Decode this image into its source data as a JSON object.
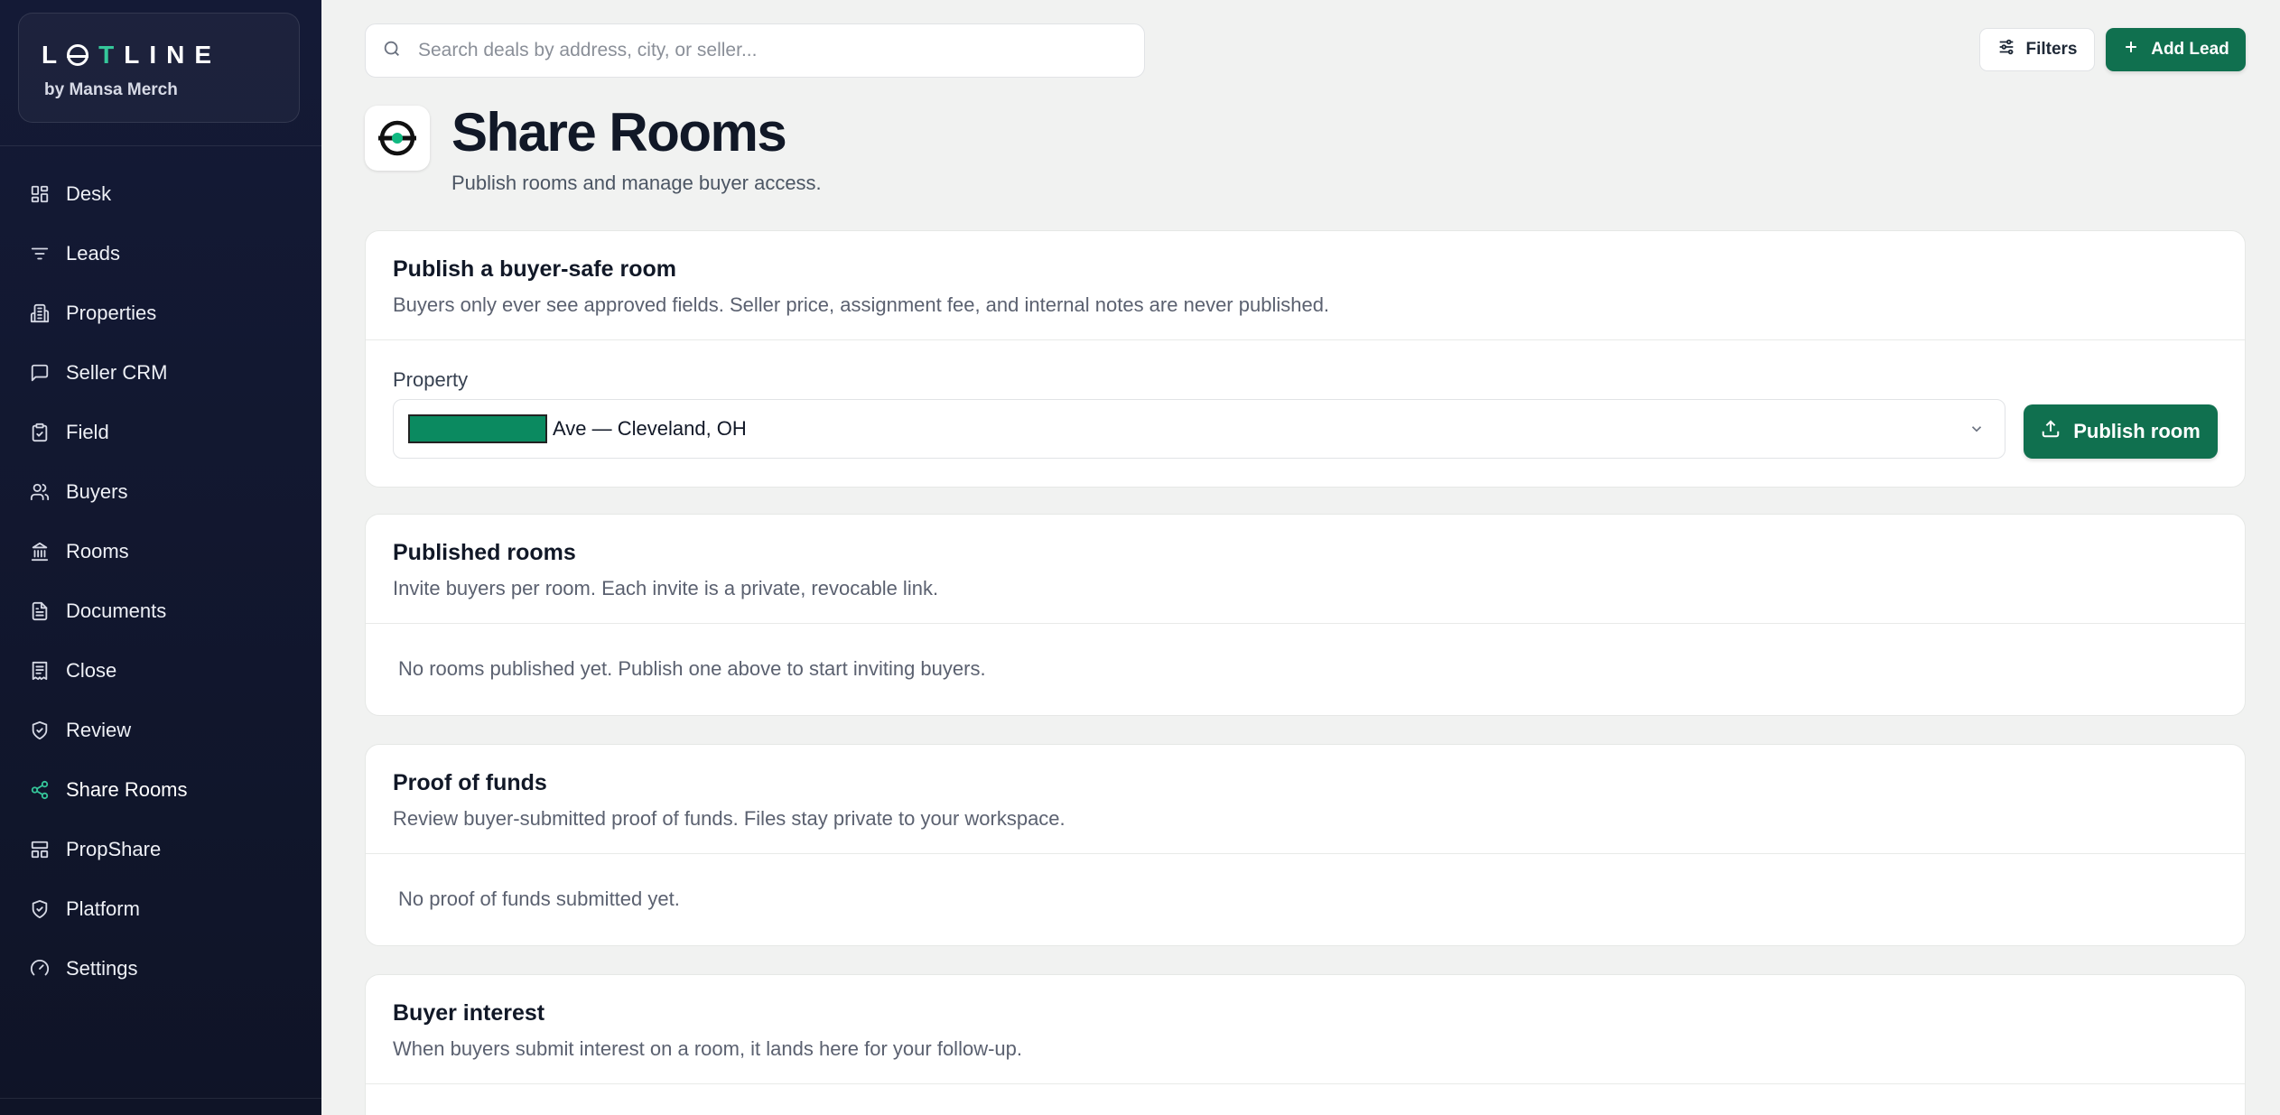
{
  "brand": {
    "logo_parts": [
      "L",
      "",
      "T",
      "LINE"
    ],
    "subtitle": "by Mansa Merch"
  },
  "sidebar": {
    "items": [
      {
        "label": "Desk",
        "icon": "grid-icon",
        "active": false
      },
      {
        "label": "Leads",
        "icon": "filter-lines-icon",
        "active": false
      },
      {
        "label": "Properties",
        "icon": "building-icon",
        "active": false
      },
      {
        "label": "Seller CRM",
        "icon": "message-icon",
        "active": false
      },
      {
        "label": "Field",
        "icon": "clipboard-icon",
        "active": false
      },
      {
        "label": "Buyers",
        "icon": "users-icon",
        "active": false
      },
      {
        "label": "Rooms",
        "icon": "bank-icon",
        "active": false
      },
      {
        "label": "Documents",
        "icon": "file-icon",
        "active": false
      },
      {
        "label": "Close",
        "icon": "receipt-icon",
        "active": false
      },
      {
        "label": "Review",
        "icon": "shield-check-icon",
        "active": false
      },
      {
        "label": "Share Rooms",
        "icon": "share-icon",
        "active": true
      },
      {
        "label": "PropShare",
        "icon": "layout-icon",
        "active": false
      },
      {
        "label": "Platform",
        "icon": "shield-check-icon",
        "active": false
      },
      {
        "label": "Settings",
        "icon": "gauge-icon",
        "active": false
      }
    ]
  },
  "topbar": {
    "search_placeholder": "Search deals by address, city, or seller...",
    "filters_label": "Filters",
    "add_lead_label": "Add Lead"
  },
  "header": {
    "title": "Share Rooms",
    "subtitle": "Publish rooms and manage buyer access."
  },
  "publish_card": {
    "title": "Publish a buyer-safe room",
    "description": "Buyers only ever see approved fields. Seller price, assignment fee, and internal notes are never published.",
    "property_label": "Property",
    "property_value": "Ave — Cleveland, OH",
    "publish_button": "Publish room"
  },
  "published_card": {
    "title": "Published rooms",
    "description": "Invite buyers per room. Each invite is a private, revocable link.",
    "empty": "No rooms published yet. Publish one above to start inviting buyers."
  },
  "pof_card": {
    "title": "Proof of funds",
    "description": "Review buyer-submitted proof of funds. Files stay private to your workspace.",
    "empty": "No proof of funds submitted yet."
  },
  "interest_card": {
    "title": "Buyer interest",
    "description": "When buyers submit interest on a room, it lands here for your follow-up."
  },
  "colors": {
    "accent": "#10704f",
    "active_icon": "#35c79a",
    "sidebar_bg": "#141a36",
    "redaction": "#0b8a60"
  }
}
